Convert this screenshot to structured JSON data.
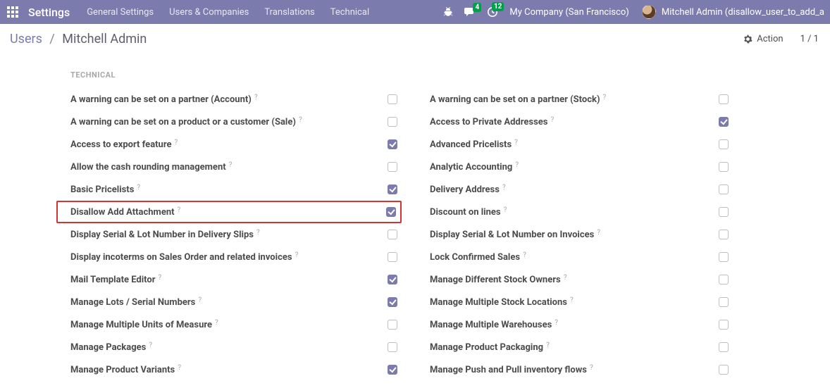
{
  "nav": {
    "brand": "Settings",
    "links": [
      "General Settings",
      "Users & Companies",
      "Translations",
      "Technical"
    ],
    "messaging_count": "4",
    "activities_count": "12",
    "company": "My Company (San Francisco)",
    "user": "Mitchell Admin (disallow_user_to_add_a"
  },
  "breadcrumb": {
    "root": "Users",
    "current": "Mitchell Admin"
  },
  "actions": {
    "action_label": "Action",
    "pager": "1 / 1"
  },
  "section_title": "TECHNICAL",
  "help": "?",
  "left": [
    {
      "label": "A warning can be set on a partner (Account)",
      "checked": false
    },
    {
      "label": "A warning can be set on a product or a customer (Sale)",
      "checked": false
    },
    {
      "label": "Access to export feature",
      "checked": true
    },
    {
      "label": "Allow the cash rounding management",
      "checked": false
    },
    {
      "label": "Basic Pricelists",
      "checked": true
    },
    {
      "label": "Disallow Add Attachment",
      "checked": true,
      "highlight": true
    },
    {
      "label": "Display Serial & Lot Number in Delivery Slips",
      "checked": false
    },
    {
      "label": "Display incoterms on Sales Order and related invoices",
      "checked": false
    },
    {
      "label": "Mail Template Editor",
      "checked": true
    },
    {
      "label": "Manage Lots / Serial Numbers",
      "checked": true
    },
    {
      "label": "Manage Multiple Units of Measure",
      "checked": false
    },
    {
      "label": "Manage Packages",
      "checked": false
    },
    {
      "label": "Manage Product Variants",
      "checked": true
    }
  ],
  "right": [
    {
      "label": "A warning can be set on a partner (Stock)",
      "checked": false
    },
    {
      "label": "Access to Private Addresses",
      "checked": true
    },
    {
      "label": "Advanced Pricelists",
      "checked": false
    },
    {
      "label": "Analytic Accounting",
      "checked": false
    },
    {
      "label": "Delivery Address",
      "checked": false
    },
    {
      "label": "Discount on lines",
      "checked": false
    },
    {
      "label": "Display Serial & Lot Number on Invoices",
      "checked": false
    },
    {
      "label": "Lock Confirmed Sales",
      "checked": false
    },
    {
      "label": "Manage Different Stock Owners",
      "checked": false
    },
    {
      "label": "Manage Multiple Stock Locations",
      "checked": false
    },
    {
      "label": "Manage Multiple Warehouses",
      "checked": false
    },
    {
      "label": "Manage Product Packaging",
      "checked": false
    },
    {
      "label": "Manage Push and Pull inventory flows",
      "checked": false
    }
  ]
}
